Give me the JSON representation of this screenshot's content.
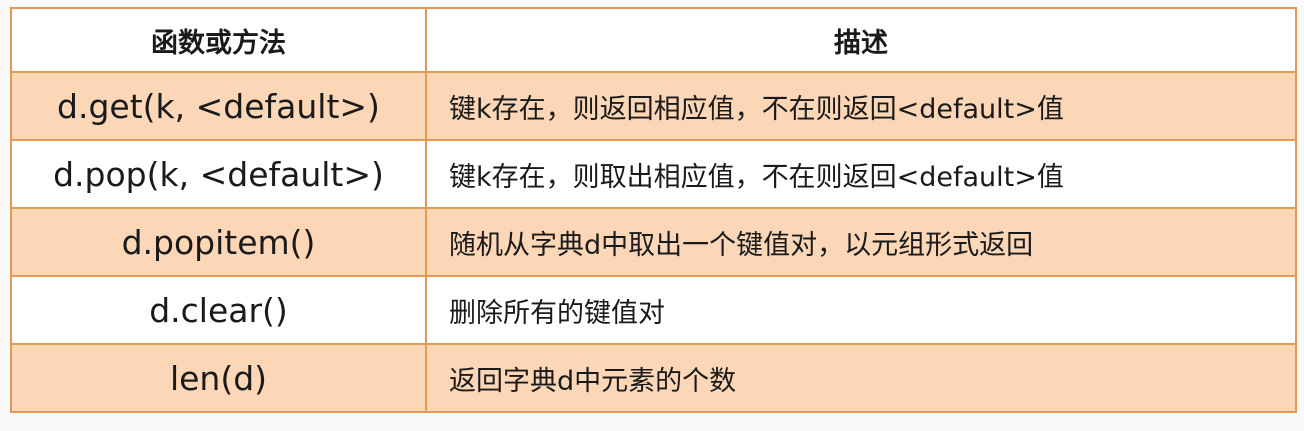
{
  "table": {
    "headers": [
      "函数或方法",
      "描述"
    ],
    "rows": [
      {
        "fn": "d.get(k, <default>)",
        "desc": "键k存在，则返回相应值，不在则返回<default>值"
      },
      {
        "fn": "d.pop(k, <default>)",
        "desc": "键k存在，则取出相应值，不在则返回<default>值"
      },
      {
        "fn": "d.popitem()",
        "desc": "随机从字典d中取出一个键值对，以元组形式返回"
      },
      {
        "fn": "d.clear()",
        "desc": "删除所有的键值对"
      },
      {
        "fn": "len(d)",
        "desc": "返回字典d中元素的个数"
      }
    ]
  },
  "colors": {
    "border": "#e39a54",
    "row_shade": "#fbd7b7",
    "text": "#1a1a1a"
  }
}
